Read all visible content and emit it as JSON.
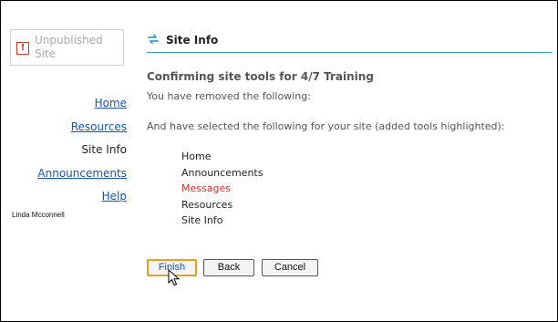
{
  "status": {
    "label_line1": "Unpublished",
    "label_line2": "Site",
    "icon": "warning-icon",
    "icon_glyph": "!"
  },
  "nav": {
    "items": [
      {
        "label": "Home",
        "current": false
      },
      {
        "label": "Resources",
        "current": false
      },
      {
        "label": "Site Info",
        "current": true
      },
      {
        "label": "Announcements",
        "current": false
      },
      {
        "label": "Help",
        "current": false
      }
    ]
  },
  "user": {
    "name": "Linda Mcconnell"
  },
  "main": {
    "title": "Site Info",
    "title_icon": "refresh-icon",
    "heading": "Confirming site tools for 4/7 Training",
    "removed_text": "You have removed the following:",
    "selected_text": "And have selected the following for your site (added tools highlighted):",
    "tools": [
      {
        "label": "Home",
        "added": false
      },
      {
        "label": "Announcements",
        "added": false
      },
      {
        "label": "Messages",
        "added": true
      },
      {
        "label": "Resources",
        "added": false
      },
      {
        "label": "Site Info",
        "added": false
      }
    ]
  },
  "buttons": {
    "finish": "Finish",
    "back": "Back",
    "cancel": "Cancel"
  },
  "colors": {
    "link": "#1a54a8",
    "added_tool": "#c0392b",
    "title_rule": "#3aa0c8",
    "finish_focus": "#e0a020"
  }
}
